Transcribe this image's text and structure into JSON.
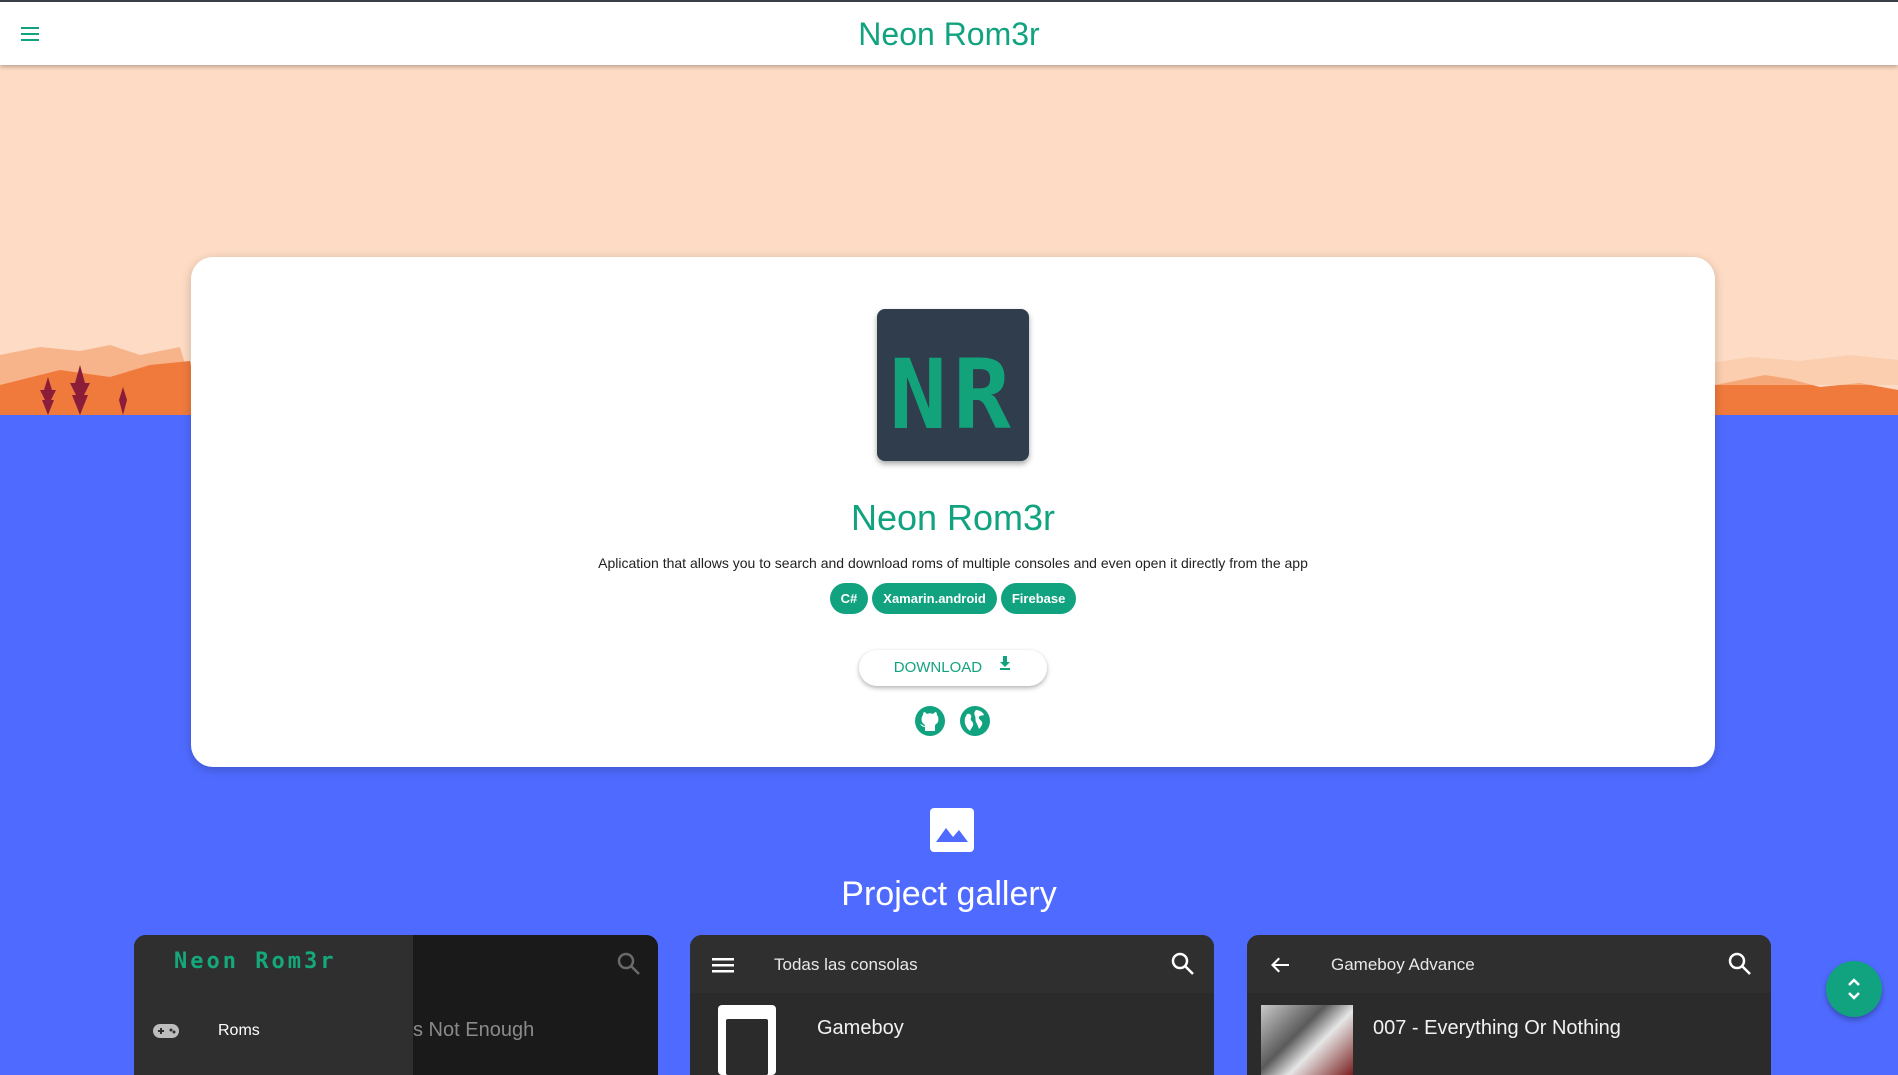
{
  "header": {
    "title": "Neon Rom3r",
    "menu_icon": "menu-icon"
  },
  "project": {
    "icon_text": "NR",
    "title": "Neon Rom3r",
    "description": "Aplication that allows you to search and download roms of multiple consoles and even open it directly from the app",
    "tags": [
      "C#",
      "Xamarin.android",
      "Firebase"
    ],
    "download_label": "DOWNLOAD",
    "links": [
      {
        "icon": "github-icon"
      },
      {
        "icon": "globe-icon"
      }
    ]
  },
  "gallery": {
    "icon": "image-icon",
    "title": "Project gallery",
    "screenshots": [
      {
        "drawer_logo": "Neon Rom3r",
        "drawer_item": "Roms",
        "behind_text": "s Not Enough"
      },
      {
        "bar_title": "Todas las consolas",
        "row_text": "Gameboy"
      },
      {
        "bar_title": "Gameboy Advance",
        "row_text": "007 - Everything Or Nothing"
      }
    ]
  },
  "fab": {
    "icon": "unfold-icon"
  },
  "colors": {
    "accent": "#11a37f",
    "sky": "#fddbc4",
    "blue": "#4f6bff",
    "mountain": "#f07a3c"
  }
}
